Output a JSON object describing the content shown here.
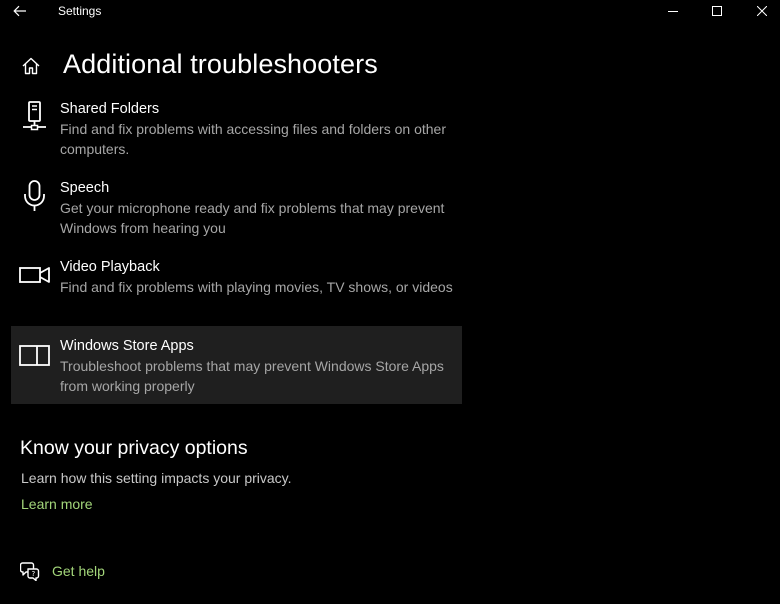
{
  "window": {
    "title": "Settings",
    "icons": {
      "back": "back-arrow-icon",
      "minimize": "minimize-icon",
      "maximize": "maximize-icon",
      "close": "close-icon"
    }
  },
  "page": {
    "title": "Additional troubleshooters",
    "home_icon": "home-icon"
  },
  "troubleshooters": [
    {
      "name": "Shared Folders",
      "description": "Find and fix problems with accessing files and folders on other computers.",
      "icon": "network-computer-icon"
    },
    {
      "name": "Speech",
      "description": "Get your microphone ready and fix problems that may prevent Windows from hearing you",
      "icon": "microphone-icon"
    },
    {
      "name": "Video Playback",
      "description": "Find and fix problems with playing movies, TV shows, or videos",
      "icon": "video-camera-icon"
    },
    {
      "name": "Windows Store Apps",
      "description": "Troubleshoot problems that may prevent Windows Store Apps from working properly",
      "icon": "store-apps-icon",
      "selected": true
    }
  ],
  "privacy": {
    "title": "Know your privacy options",
    "text": "Learn how this setting impacts your privacy.",
    "link": "Learn more"
  },
  "help": {
    "label": "Get help",
    "icon": "chat-help-icon"
  },
  "colors": {
    "background": "#000000",
    "selected_item": "#1f1f1f",
    "secondary_text": "#a6a6a6",
    "link": "#a3d67a"
  }
}
